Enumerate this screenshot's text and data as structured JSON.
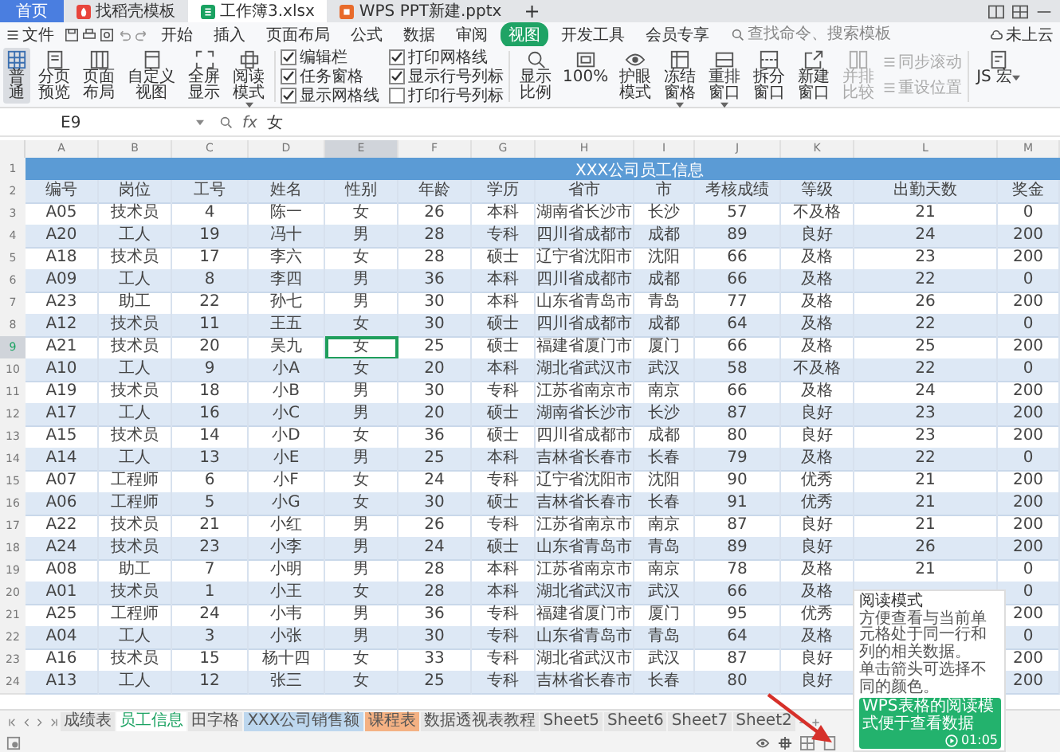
{
  "tabs": [
    {
      "label": "首页",
      "kind": "home",
      "selected": false
    },
    {
      "label": "找稻壳模板",
      "kind": "docer",
      "selected": false
    },
    {
      "label": "工作簿3.xlsx",
      "kind": "sheet",
      "selected": true
    },
    {
      "label": "WPS PPT新建.pptx",
      "kind": "ppt",
      "selected": false
    }
  ],
  "new_tab": "+",
  "menu": {
    "file": "文件",
    "items": [
      {
        "label": "开始",
        "selected": false
      },
      {
        "label": "插入",
        "selected": false
      },
      {
        "label": "页面布局",
        "selected": false
      },
      {
        "label": "公式",
        "selected": false
      },
      {
        "label": "数据",
        "selected": false
      },
      {
        "label": "审阅",
        "selected": false
      },
      {
        "label": "视图",
        "selected": true
      },
      {
        "label": "开发工具",
        "selected": false
      },
      {
        "label": "会员专享",
        "selected": false
      }
    ],
    "search_placeholder": "查找命令、搜索模板",
    "cloud": "未上云"
  },
  "ribbon": {
    "views": [
      {
        "label": "普通",
        "selected": true,
        "menu": false
      },
      {
        "label": "分页预览",
        "selected": false,
        "menu": false
      },
      {
        "label": "页面布局",
        "selected": false,
        "menu": false
      },
      {
        "label": "自定义视图",
        "selected": false,
        "menu": false
      },
      {
        "label": "全屏显示",
        "selected": false,
        "menu": false
      },
      {
        "label": "阅读模式",
        "selected": false,
        "menu": true
      }
    ],
    "checkboxes": [
      {
        "label": "编辑栏",
        "checked": true
      },
      {
        "label": "任务窗格",
        "checked": true
      },
      {
        "label": "显示网格线",
        "checked": true
      },
      {
        "label": "打印网格线",
        "checked": true
      },
      {
        "label": "显示行号列标",
        "checked": true
      },
      {
        "label": "打印行号列标",
        "checked": false
      }
    ],
    "tools": [
      {
        "label": "显示比例",
        "disabled": false,
        "menu": false
      },
      {
        "label": "100%",
        "disabled": false,
        "menu": false
      },
      {
        "label": "护眼模式",
        "disabled": false,
        "menu": false
      },
      {
        "label": "冻结窗格",
        "disabled": false,
        "menu": true
      },
      {
        "label": "重排窗口",
        "disabled": false,
        "menu": true
      },
      {
        "label": "拆分窗口",
        "disabled": false,
        "menu": false
      },
      {
        "label": "新建窗口",
        "disabled": false,
        "menu": false
      },
      {
        "label": "并排比较",
        "disabled": true,
        "menu": false
      }
    ],
    "stack": [
      {
        "label": "同步滚动",
        "disabled": true
      },
      {
        "label": "重设位置",
        "disabled": true
      }
    ],
    "macro": {
      "label": "JS 宏",
      "disabled": false,
      "menu": true
    }
  },
  "formula_bar": {
    "cell": "E9",
    "fx": "fx",
    "value": "女"
  },
  "sheet": {
    "columns": [
      {
        "letter": "A",
        "selected": false
      },
      {
        "letter": "B",
        "selected": false
      },
      {
        "letter": "C",
        "selected": false
      },
      {
        "letter": "D",
        "selected": false
      },
      {
        "letter": "E",
        "selected": true
      },
      {
        "letter": "F",
        "selected": false
      },
      {
        "letter": "G",
        "selected": false
      },
      {
        "letter": "H",
        "selected": false
      },
      {
        "letter": "I",
        "selected": false
      },
      {
        "letter": "J",
        "selected": false
      },
      {
        "letter": "K",
        "selected": false
      },
      {
        "letter": "L",
        "selected": false
      },
      {
        "letter": "M",
        "selected": false
      }
    ],
    "title_row": {
      "num": "1",
      "title": "XXX公司员工信息"
    },
    "header_row": {
      "num": "2",
      "cells": [
        "编号",
        "岗位",
        "工号",
        "姓名",
        "性别",
        "年龄",
        "学历",
        "省市",
        "市",
        "考核成绩",
        "等级",
        "出勤天数",
        "奖金"
      ]
    },
    "rows": [
      {
        "num": "3",
        "selected": false,
        "cells": [
          "A05",
          "技术员",
          "4",
          "陈一",
          "女",
          "26",
          "本科",
          "湖南省长沙市",
          "长沙",
          "57",
          "不及格",
          "21",
          "0"
        ]
      },
      {
        "num": "4",
        "selected": false,
        "cells": [
          "A20",
          "工人",
          "19",
          "冯十",
          "男",
          "28",
          "专科",
          "四川省成都市",
          "成都",
          "89",
          "良好",
          "24",
          "200"
        ]
      },
      {
        "num": "5",
        "selected": false,
        "cells": [
          "A18",
          "技术员",
          "17",
          "李六",
          "女",
          "28",
          "硕士",
          "辽宁省沈阳市",
          "沈阳",
          "66",
          "及格",
          "23",
          "200"
        ]
      },
      {
        "num": "6",
        "selected": false,
        "cells": [
          "A09",
          "工人",
          "8",
          "李四",
          "男",
          "36",
          "本科",
          "四川省成都市",
          "成都",
          "66",
          "及格",
          "22",
          "0"
        ]
      },
      {
        "num": "7",
        "selected": false,
        "cells": [
          "A23",
          "助工",
          "22",
          "孙七",
          "男",
          "30",
          "本科",
          "山东省青岛市",
          "青岛",
          "77",
          "及格",
          "26",
          "200"
        ]
      },
      {
        "num": "8",
        "selected": false,
        "cells": [
          "A12",
          "技术员",
          "11",
          "王五",
          "女",
          "30",
          "硕士",
          "四川省成都市",
          "成都",
          "64",
          "及格",
          "22",
          "0"
        ]
      },
      {
        "num": "9",
        "selected": true,
        "cells": [
          "A21",
          "技术员",
          "20",
          "吴九",
          "女",
          "25",
          "硕士",
          "福建省厦门市",
          "厦门",
          "66",
          "及格",
          "25",
          "200"
        ]
      },
      {
        "num": "10",
        "selected": false,
        "cells": [
          "A10",
          "工人",
          "9",
          "小A",
          "女",
          "20",
          "本科",
          "湖北省武汉市",
          "武汉",
          "58",
          "不及格",
          "22",
          "0"
        ]
      },
      {
        "num": "11",
        "selected": false,
        "cells": [
          "A19",
          "技术员",
          "18",
          "小B",
          "男",
          "30",
          "专科",
          "江苏省南京市",
          "南京",
          "66",
          "及格",
          "24",
          "200"
        ]
      },
      {
        "num": "12",
        "selected": false,
        "cells": [
          "A17",
          "工人",
          "16",
          "小C",
          "男",
          "20",
          "硕士",
          "湖南省长沙市",
          "长沙",
          "87",
          "良好",
          "23",
          "200"
        ]
      },
      {
        "num": "13",
        "selected": false,
        "cells": [
          "A15",
          "技术员",
          "14",
          "小D",
          "女",
          "36",
          "硕士",
          "四川省成都市",
          "成都",
          "80",
          "良好",
          "23",
          "200"
        ]
      },
      {
        "num": "14",
        "selected": false,
        "cells": [
          "A14",
          "工人",
          "13",
          "小E",
          "男",
          "25",
          "本科",
          "吉林省长春市",
          "长春",
          "79",
          "及格",
          "22",
          "0"
        ]
      },
      {
        "num": "15",
        "selected": false,
        "cells": [
          "A07",
          "工程师",
          "6",
          "小F",
          "女",
          "24",
          "专科",
          "辽宁省沈阳市",
          "沈阳",
          "90",
          "优秀",
          "21",
          "200"
        ]
      },
      {
        "num": "16",
        "selected": false,
        "cells": [
          "A06",
          "工程师",
          "5",
          "小G",
          "女",
          "30",
          "硕士",
          "吉林省长春市",
          "长春",
          "91",
          "优秀",
          "21",
          "200"
        ]
      },
      {
        "num": "17",
        "selected": false,
        "cells": [
          "A22",
          "技术员",
          "21",
          "小红",
          "男",
          "26",
          "专科",
          "江苏省南京市",
          "南京",
          "87",
          "良好",
          "21",
          "200"
        ]
      },
      {
        "num": "18",
        "selected": false,
        "cells": [
          "A24",
          "技术员",
          "23",
          "小李",
          "男",
          "24",
          "硕士",
          "山东省青岛市",
          "青岛",
          "89",
          "良好",
          "26",
          "200"
        ]
      },
      {
        "num": "19",
        "selected": false,
        "cells": [
          "A08",
          "助工",
          "7",
          "小明",
          "男",
          "28",
          "本科",
          "江苏省南京市",
          "南京",
          "78",
          "及格",
          "21",
          "0"
        ]
      },
      {
        "num": "20",
        "selected": false,
        "cells": [
          "A01",
          "技术员",
          "1",
          "小王",
          "女",
          "28",
          "本科",
          "湖北省武汉市",
          "武汉",
          "66",
          "及格",
          null,
          "0"
        ]
      },
      {
        "num": "21",
        "selected": false,
        "cells": [
          "A25",
          "工程师",
          "24",
          "小韦",
          "男",
          "36",
          "专科",
          "福建省厦门市",
          "厦门",
          "95",
          "优秀",
          null,
          "200"
        ]
      },
      {
        "num": "22",
        "selected": false,
        "cells": [
          "A04",
          "工人",
          "3",
          "小张",
          "男",
          "30",
          "专科",
          "山东省青岛市",
          "青岛",
          "64",
          "及格",
          null,
          "0"
        ]
      },
      {
        "num": "23",
        "selected": false,
        "cells": [
          "A16",
          "技术员",
          "15",
          "杨十四",
          "女",
          "33",
          "专科",
          "湖北省武汉市",
          "武汉",
          "87",
          "良好",
          null,
          "200"
        ]
      },
      {
        "num": "24",
        "selected": false,
        "cells": [
          "A13",
          "工人",
          "12",
          "张三",
          "女",
          "25",
          "专科",
          "吉林省长春市",
          "长春",
          "80",
          "良好",
          null,
          "200"
        ]
      }
    ]
  },
  "sheet_tabs": [
    {
      "label": "成绩表",
      "selected": false,
      "color": "#e6e6e6"
    },
    {
      "label": "员工信息",
      "selected": true,
      "color": "#ffffff"
    },
    {
      "label": "田字格",
      "selected": false,
      "color": "#e6e6e6"
    },
    {
      "label": "XXX公司销售额",
      "selected": false,
      "color": "#bdd7ee"
    },
    {
      "label": "课程表",
      "selected": false,
      "color": "#f4b183"
    },
    {
      "label": "数据透视表教程",
      "selected": false,
      "color": "#e6e6e6"
    },
    {
      "label": "Sheet5",
      "selected": false,
      "color": "#e6e6e6"
    },
    {
      "label": "Sheet6",
      "selected": false,
      "color": "#e6e6e6"
    },
    {
      "label": "Sheet7",
      "selected": false,
      "color": "#e6e6e6"
    },
    {
      "label": "Sheet2",
      "selected": false,
      "color": "#e6e6e6"
    }
  ],
  "popup": {
    "title": "阅读模式",
    "paragraphs": [
      "方便查看与当前单元格处于同一行和列的相关数据。",
      "单击箭头可选择不同的颜色。"
    ],
    "card_text": "WPS表格的阅读模式便于查看数据",
    "duration": "01:05"
  }
}
